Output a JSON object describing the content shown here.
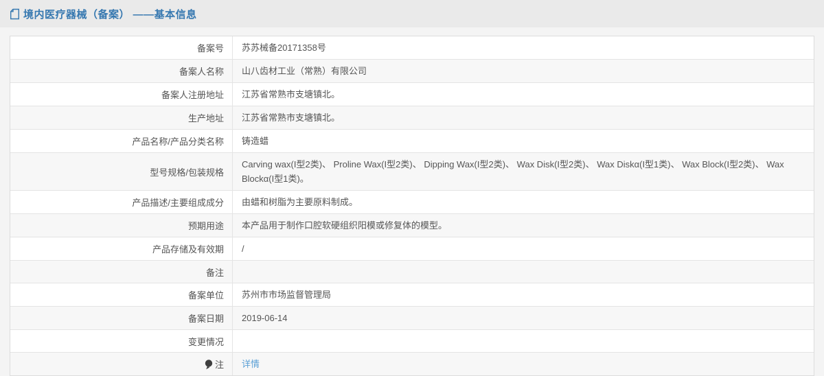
{
  "page": {
    "title": "境内医疗器械（备案） ——基本信息",
    "title_icon": "document-icon"
  },
  "table": {
    "rows": [
      {
        "label": "备案号",
        "value": "苏苏械备20171358号",
        "type": "text"
      },
      {
        "label": "备案人名称",
        "value": "山八齿材工业（常熟）有限公司",
        "type": "text"
      },
      {
        "label": "备案人注册地址",
        "value": "江苏省常熟市支塘镇北。",
        "type": "text"
      },
      {
        "label": "生产地址",
        "value": "江苏省常熟市支塘镇北。",
        "type": "text"
      },
      {
        "label": "产品名称/产品分类名称",
        "value": "铸造蜡",
        "type": "text"
      },
      {
        "label": "型号规格/包装规格",
        "value": "Carving wax(I型2类)、 Proline Wax(I型2类)、 Dipping Wax(I型2类)、 Wax Disk(I型2类)、 Wax Diskα(I型1类)、 Wax Block(I型2类)、 Wax Blockα(I型1类)。",
        "type": "text"
      },
      {
        "label": "产品描述/主要组成成分",
        "value": "由蜡和树脂为主要原料制成。",
        "type": "text"
      },
      {
        "label": "预期用途",
        "value": "本产品用于制作口腔软硬组织阳模或修复体的模型。",
        "type": "text"
      },
      {
        "label": "产品存储及有效期",
        "value": "/",
        "type": "text"
      },
      {
        "label": "备注",
        "value": "",
        "type": "text"
      },
      {
        "label": "备案单位",
        "value": "苏州市市场监督管理局",
        "type": "text"
      },
      {
        "label": "备案日期",
        "value": "2019-06-14",
        "type": "text"
      },
      {
        "label": "变更情况",
        "value": "",
        "type": "text"
      },
      {
        "label": "注",
        "value": "详情",
        "type": "link",
        "label_icon": "balloon-note-icon"
      }
    ]
  },
  "colors": {
    "title_blue": "#3678b0",
    "link_blue": "#5a9fd5",
    "header_bg": "#eaeaea",
    "page_bg": "#f4f4f4",
    "row_alt_bg": "#f7f7f7",
    "border": "#e4e4e4",
    "text": "#555555",
    "note_icon": "#3f3f3f"
  },
  "icons": {
    "title_icon": "document-icon",
    "note_icon": "balloon-note-icon"
  }
}
